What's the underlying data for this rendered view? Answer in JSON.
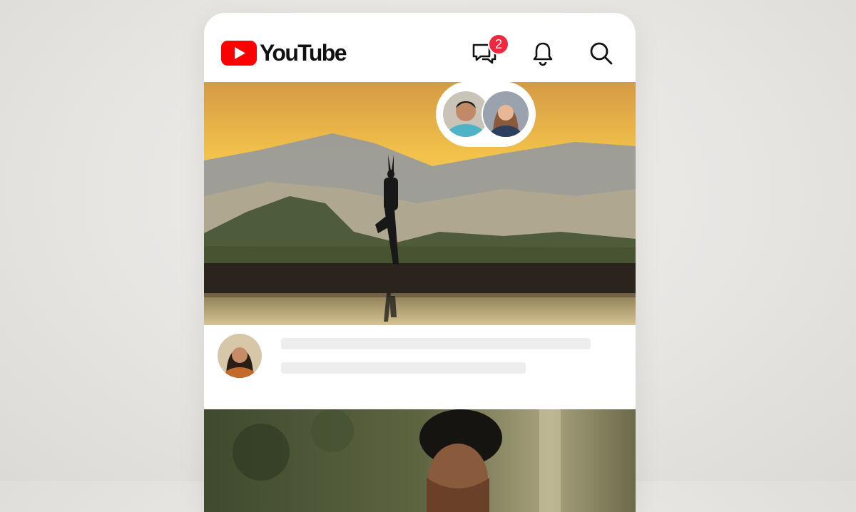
{
  "app": {
    "logo_text": "YouTube",
    "brand_color": "#ff0000"
  },
  "header": {
    "icons": [
      "chat-bubbles-icon",
      "bell-icon",
      "search-icon"
    ],
    "notification_count": "2",
    "badge_color": "#f0283f"
  },
  "feed": {
    "items": [
      {
        "thumbnail": "yoga-sunset-mountains",
        "watching_avatars": 2,
        "skeleton_lines": 2
      },
      {
        "thumbnail": "smiling-man-forest"
      }
    ]
  }
}
